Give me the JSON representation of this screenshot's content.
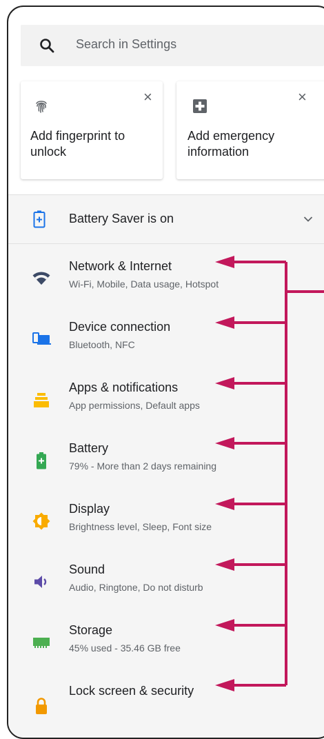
{
  "search": {
    "placeholder": "Search in Settings",
    "icon": "search-icon"
  },
  "cards": [
    {
      "label": "Add fingerprint to unlock",
      "line1": "Add fingerprint to",
      "line2": "unlock",
      "icon": "fingerprint-icon"
    },
    {
      "label": "Add emergency information",
      "line1": "Add emergency",
      "line2": "information",
      "icon": "medical-plus-icon"
    }
  ],
  "battery_saver": {
    "label": "Battery Saver is on",
    "icon": "battery-saver-icon"
  },
  "settings": [
    {
      "title": "Network & Internet",
      "subtitle": "Wi-Fi, Mobile, Data usage, Hotspot",
      "icon": "wifi-icon",
      "color": "#3c4a66"
    },
    {
      "title": "Device connection",
      "subtitle": "Bluetooth, NFC",
      "icon": "devices-icon",
      "color": "#1a73e8"
    },
    {
      "title": "Apps & notifications",
      "subtitle": "App permissions, Default apps",
      "icon": "apps-icon",
      "color": "#fbbc04"
    },
    {
      "title": "Battery",
      "subtitle": "79% - More than 2 days remaining",
      "icon": "battery-icon",
      "color": "#34a853"
    },
    {
      "title": "Display",
      "subtitle": "Brightness level, Sleep, Font size",
      "icon": "brightness-icon",
      "color": "#f9ab00"
    },
    {
      "title": "Sound",
      "subtitle": "Audio, Ringtone, Do not disturb",
      "icon": "volume-icon",
      "color": "#5c4ba8"
    },
    {
      "title": "Storage",
      "subtitle": "45% used - 35.46 GB free",
      "icon": "storage-icon",
      "color": "#4caf50"
    },
    {
      "title": "Lock screen & security",
      "subtitle": "",
      "icon": "lock-icon",
      "color": "#f29900"
    }
  ],
  "annotation": {
    "arrow_color": "#c2185b"
  }
}
